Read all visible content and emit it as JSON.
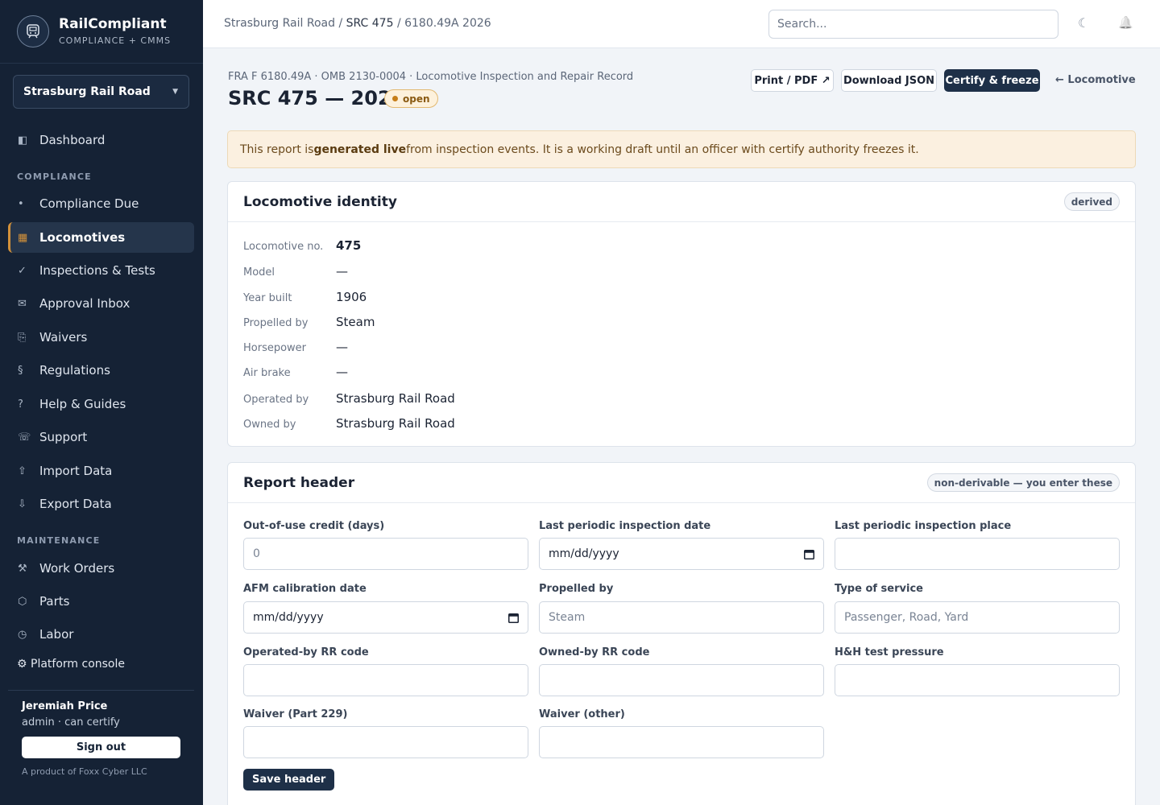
{
  "brand": {
    "name": "RailCompliant",
    "subtitle": "COMPLIANCE + CMMS"
  },
  "org": {
    "selected": "Strasburg Rail Road"
  },
  "nav": {
    "dashboard": {
      "label": "Dashboard",
      "icon": "dashboard-icon"
    },
    "compliance_section": "COMPLIANCE",
    "compliance_items": [
      {
        "label": "Compliance Due",
        "icon": "dot-icon"
      },
      {
        "label": "Locomotives",
        "icon": "locomotive-icon",
        "active": true
      },
      {
        "label": "Inspections & Tests",
        "icon": "check-icon"
      },
      {
        "label": "Approval Inbox",
        "icon": "mail-icon"
      },
      {
        "label": "Waivers",
        "icon": "waiver-icon"
      },
      {
        "label": "Regulations",
        "icon": "section-icon"
      },
      {
        "label": "Help & Guides",
        "icon": "help-icon"
      },
      {
        "label": "Support",
        "icon": "phone-icon"
      },
      {
        "label": "Import Data",
        "icon": "upload-icon"
      },
      {
        "label": "Export Data",
        "icon": "download-icon"
      }
    ],
    "maintenance_section": "MAINTENANCE",
    "maintenance_items": [
      {
        "label": "Work Orders",
        "icon": "tools-icon"
      },
      {
        "label": "Parts",
        "icon": "hexagon-icon"
      },
      {
        "label": "Labor",
        "icon": "clock-icon"
      }
    ],
    "platform": "⚙ Platform console"
  },
  "user": {
    "name": "Jeremiah Price",
    "role": "admin · can certify",
    "sign_out": "Sign out"
  },
  "footer": "A product of Foxx Cyber LLC",
  "topbar": {
    "crumbs": [
      "Strasburg Rail Road",
      "/",
      "SRC 475",
      "/",
      "6180.49A 2026"
    ],
    "search_placeholder": "Search...",
    "theme_icon": "☾",
    "bell_icon": "🔔"
  },
  "page": {
    "meta": "FRA F 6180.49A · OMB 2130-0004 · Locomotive Inspection and Repair Record",
    "title": "SRC 475 — 2026",
    "status": "open",
    "actions": {
      "print": "Print / PDF ↗",
      "download": "Download JSON",
      "certify": "Certify & freeze",
      "back": "← Locomotive"
    },
    "notice": {
      "pre": "This report is ",
      "strong": "generated live",
      "post": " from inspection events. It is a working draft until an officer with certify authority freezes it."
    }
  },
  "identity": {
    "title": "Locomotive identity",
    "tag": "derived",
    "rows": [
      {
        "label": "Locomotive no.",
        "value": "475"
      },
      {
        "label": "Model",
        "value": "—"
      },
      {
        "label": "Year built",
        "value": "1906"
      },
      {
        "label": "Propelled by",
        "value": "Steam"
      },
      {
        "label": "Horsepower",
        "value": "—"
      },
      {
        "label": "Air brake",
        "value": "—"
      },
      {
        "label": "Operated by",
        "value": "Strasburg Rail Road"
      },
      {
        "label": "Owned by",
        "value": "Strasburg Rail Road"
      }
    ]
  },
  "header_form": {
    "title": "Report header",
    "tag": "non-derivable — you enter these",
    "fields": {
      "out_of_use": {
        "label": "Out-of-use credit (days)",
        "placeholder": "0"
      },
      "last_periodic_date": {
        "label": "Last periodic inspection date",
        "value": "mm/dd/yyyy"
      },
      "last_periodic_place": {
        "label": "Last periodic inspection place",
        "value": ""
      },
      "afm_date": {
        "label": "AFM calibration date",
        "value": "mm/dd/yyyy"
      },
      "propelled_by": {
        "label": "Propelled by",
        "placeholder": "Steam"
      },
      "type_of_service": {
        "label": "Type of service",
        "placeholder": "Passenger, Road, Yard"
      },
      "operated_code": {
        "label": "Operated-by RR code",
        "value": ""
      },
      "owned_code": {
        "label": "Owned-by RR code",
        "value": ""
      },
      "hh_pressure": {
        "label": "H&H test pressure",
        "value": ""
      },
      "waiver_229": {
        "label": "Waiver (Part 229)",
        "value": ""
      },
      "waiver_other": {
        "label": "Waiver (other)",
        "value": ""
      }
    },
    "save": "Save header"
  }
}
